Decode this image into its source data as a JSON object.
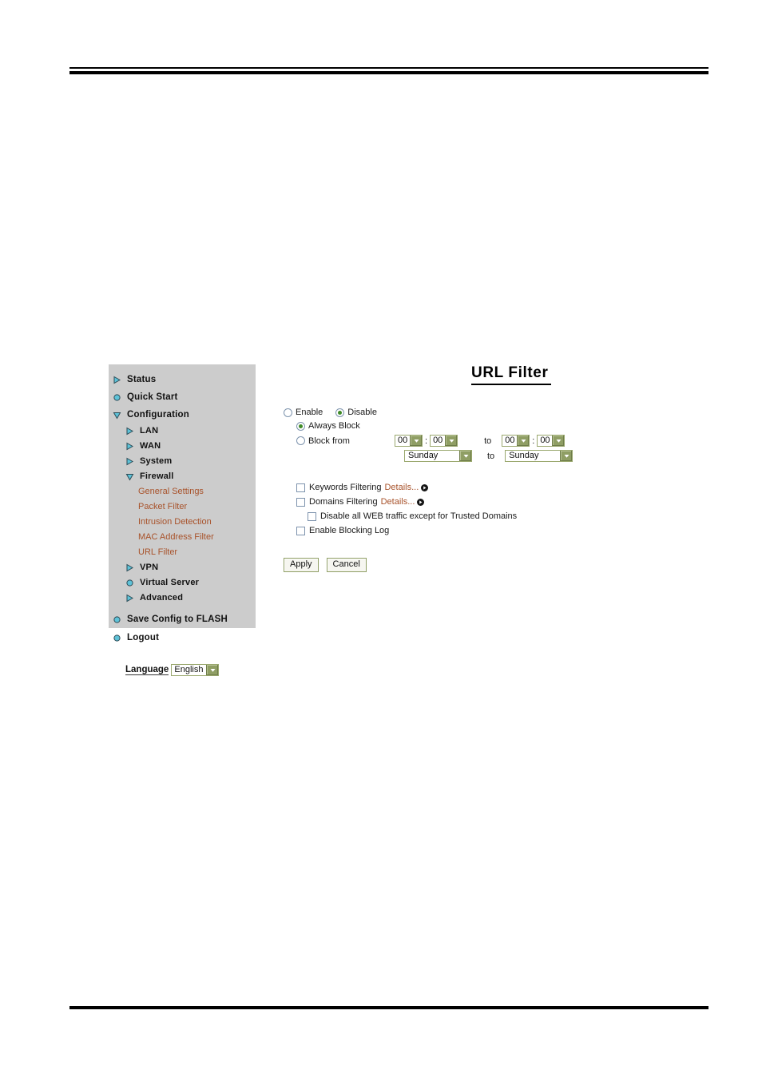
{
  "page": {
    "title": "URL Filter"
  },
  "sidebar": {
    "items": [
      {
        "label": "Status",
        "icon": "triangle-right-icon",
        "level": 0
      },
      {
        "label": "Quick Start",
        "icon": "circle-icon",
        "level": 0
      },
      {
        "label": "Configuration",
        "icon": "triangle-down-icon",
        "level": 0
      },
      {
        "label": "LAN",
        "icon": "triangle-right-icon",
        "level": 1
      },
      {
        "label": "WAN",
        "icon": "triangle-right-icon",
        "level": 1
      },
      {
        "label": "System",
        "icon": "triangle-right-icon",
        "level": 1
      },
      {
        "label": "Firewall",
        "icon": "triangle-down-icon",
        "level": 1
      },
      {
        "label": "General Settings",
        "icon": "none",
        "level": 2
      },
      {
        "label": "Packet Filter",
        "icon": "none",
        "level": 2
      },
      {
        "label": "Intrusion Detection",
        "icon": "none",
        "level": 2
      },
      {
        "label": "MAC Address Filter",
        "icon": "none",
        "level": 2
      },
      {
        "label": "URL Filter",
        "icon": "none",
        "level": 2
      },
      {
        "label": "VPN",
        "icon": "triangle-right-icon",
        "level": 1
      },
      {
        "label": "Virtual Server",
        "icon": "circle-icon",
        "level": 1
      },
      {
        "label": "Advanced",
        "icon": "triangle-right-icon",
        "level": 1
      },
      {
        "label": "Save Config to FLASH",
        "icon": "circle-icon",
        "level": 0
      },
      {
        "label": "Logout",
        "icon": "circle-icon",
        "level": 0
      }
    ],
    "language": {
      "title": "Language",
      "selected": "English"
    }
  },
  "form": {
    "enable_label": "Enable",
    "enable_selected": false,
    "disable_label": "Disable",
    "disable_selected": true,
    "always_block_label": "Always Block",
    "always_block_selected": true,
    "block_from_label": "Block from",
    "block_from_selected": false,
    "to_label": "to",
    "time": {
      "from_hour": "00",
      "from_minute": "00",
      "until_hour": "00",
      "until_minute": "00",
      "from_day": "Sunday",
      "until_day": "Sunday"
    },
    "keywords_filtering_label": "Keywords Filtering",
    "keywords_filtering_checked": false,
    "keywords_details_label": "Details...",
    "domains_filtering_label": "Domains Filtering",
    "domains_filtering_checked": false,
    "domains_details_label": "Details...",
    "disable_web_label": "Disable all WEB traffic except for Trusted Domains",
    "disable_web_checked": false,
    "blocking_log_label": "Enable Blocking Log",
    "blocking_log_checked": false,
    "apply_label": "Apply",
    "cancel_label": "Cancel"
  },
  "colors": {
    "sidebar_bg": "#cccccc",
    "submenu_link": "#a8522a",
    "icon_blue": "#5ec2d8",
    "select_border": "#9aa86e",
    "select_button": "#8f9e64",
    "radio_dot_green": "#3f8a28",
    "checkbox_border": "#7d93ad"
  }
}
